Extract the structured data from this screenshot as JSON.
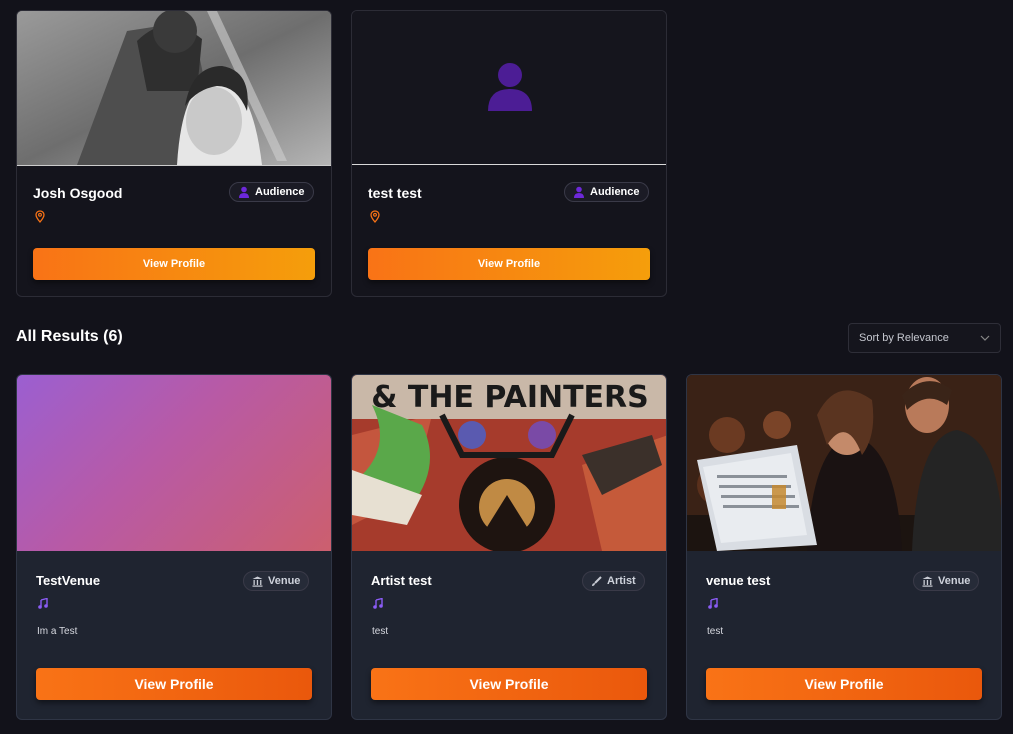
{
  "top_cards": [
    {
      "name": "Josh Osgood",
      "badge": "Audience",
      "button": "View Profile"
    },
    {
      "name": "test test",
      "badge": "Audience",
      "button": "View Profile"
    }
  ],
  "results": {
    "title": "All Results (6)",
    "sort_label": "Sort by Relevance"
  },
  "result_cards": [
    {
      "name": "TestVenue",
      "badge": "Venue",
      "description": "Im a Test",
      "button": "View Profile"
    },
    {
      "name": "Artist test",
      "badge": "Artist",
      "description": "test",
      "button": "View Profile"
    },
    {
      "name": "venue test",
      "badge": "Venue",
      "description": "test",
      "button": "View Profile"
    }
  ],
  "artwork_text": "& THE PAINTERS",
  "colors": {
    "accent": "#f97316",
    "accent2": "#f59e0b",
    "audience_icon": "#6d28d9",
    "music_icon": "#8b5cf6",
    "location_icon": "#f97316"
  }
}
